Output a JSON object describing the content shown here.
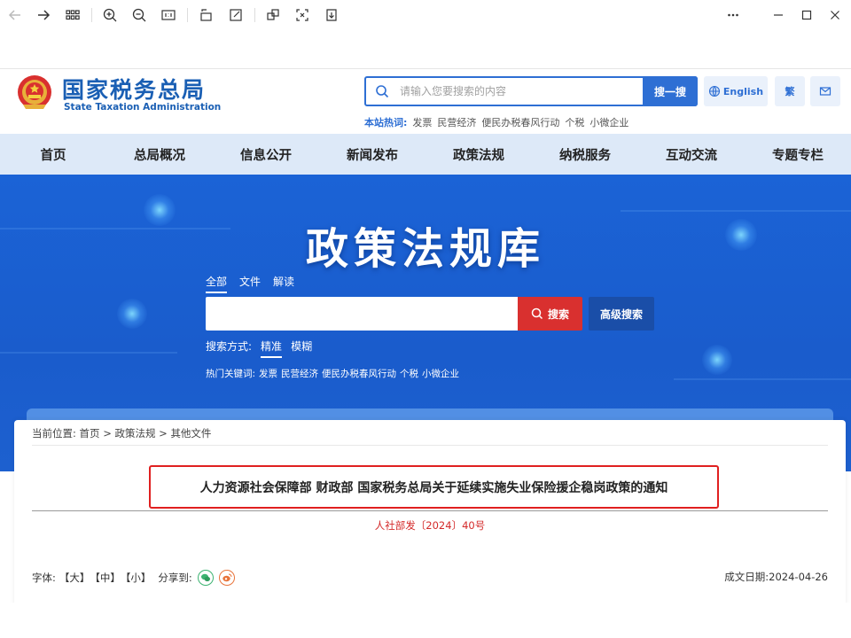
{
  "viewer": {
    "icons": [
      "arrow-left-icon",
      "arrow-right-icon",
      "grid-icon",
      "zoom-in-icon",
      "zoom-out-icon",
      "actual-size-icon",
      "rotate-icon",
      "edit-icon",
      "copy-icon",
      "crop-icon",
      "download-icon"
    ],
    "window_icons": [
      "more-icon",
      "minimize-icon",
      "maximize-icon",
      "close-icon"
    ]
  },
  "header": {
    "logo_cn": "国家税务总局",
    "logo_en": "State Taxation Administration",
    "search_placeholder": "请输入您要搜索的内容",
    "search_button": "搜一搜",
    "english_button": "English",
    "traditional_button": "繁",
    "hot_label": "本站热词:",
    "hot_words": [
      "发票",
      "民营经济",
      "便民办税春风行动",
      "个税",
      "小微企业"
    ]
  },
  "nav": {
    "items": [
      "首页",
      "总局概况",
      "信息公开",
      "新闻发布",
      "政策法规",
      "纳税服务",
      "互动交流",
      "专题专栏"
    ]
  },
  "banner": {
    "title": "政策法规库",
    "tabs": [
      "全部",
      "文件",
      "解读"
    ],
    "active_tab": "全部",
    "search_value": "",
    "search_button": "搜索",
    "advanced_button": "高级搜索",
    "mode_label": "搜索方式:",
    "modes": [
      "精准",
      "模糊"
    ],
    "active_mode": "精准",
    "hot_label": "热门关键词:",
    "hot_words": [
      "发票",
      "民营经济",
      "便民办税春风行动",
      "个税",
      "小微企业"
    ]
  },
  "breadcrumb": {
    "label": "当前位置:",
    "items": [
      "首页",
      "政策法规",
      "其他文件"
    ],
    "separator": ">"
  },
  "document": {
    "title": "人力资源社会保障部 财政部 国家税务总局关于延续实施失业保险援企稳岗政策的通知",
    "number": "人社部发〔2024〕40号",
    "font_label": "字体:",
    "font_sizes": [
      "【大】",
      "【中】",
      "【小】"
    ],
    "share_label": "分享到:",
    "share_icons": [
      "wechat-icon",
      "weibo-icon"
    ],
    "date_label": "成文日期:",
    "date": "2024-04-26"
  },
  "colors": {
    "brand_blue": "#2e6fd4",
    "banner_blue": "#1b63d6",
    "red_accent": "#d9302f",
    "highlight_border": "#e02020",
    "nav_bg": "#dde9f8"
  }
}
